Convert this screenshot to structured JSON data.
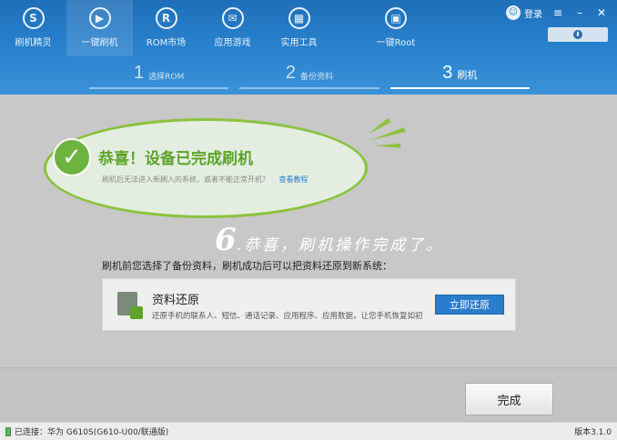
{
  "nav": {
    "items": [
      {
        "label": "刷机精灵",
        "icon": "shield-logo-icon",
        "glyph": "S"
      },
      {
        "label": "一键刷机",
        "icon": "cursor-icon",
        "glyph": "▶"
      },
      {
        "label": "ROM市场",
        "icon": "rom-icon",
        "glyph": "R"
      },
      {
        "label": "应用游戏",
        "icon": "mail-icon",
        "glyph": "✉"
      },
      {
        "label": "实用工具",
        "icon": "grid-icon",
        "glyph": "▦"
      }
    ],
    "root": {
      "label": "一键Root",
      "icon": "root-box-icon",
      "glyph": "▣"
    },
    "login_label": "登录"
  },
  "steps": [
    {
      "num": "1",
      "label": "选择ROM"
    },
    {
      "num": "2",
      "label": "备份资料"
    },
    {
      "num": "3",
      "label": "刷机"
    }
  ],
  "success": {
    "title": "恭喜！设备已完成刷机",
    "subtitle": "刷机后无法进入新刷入的系统，或者不能正常开机？",
    "link": "查看教程"
  },
  "caption": {
    "num": "6",
    "text": ".恭喜，刷机操作完成了。"
  },
  "backup_note": "刷机前您选择了备份资料，刷机成功后可以把资料还原到新系统：",
  "restore": {
    "title": "资料还原",
    "desc": "还原手机的联系人、短信、通话记录、应用程序、应用数据，让您手机恢复如初",
    "button": "立即还原"
  },
  "finish_button": "完成",
  "status": {
    "connected": "已连接：华为 G610S(G610-U00/联通版)",
    "version": "版本3.1.0"
  },
  "colors": {
    "header": "#2a83cf",
    "accent_green": "#6db33f",
    "button_blue": "#2a7ccc"
  }
}
